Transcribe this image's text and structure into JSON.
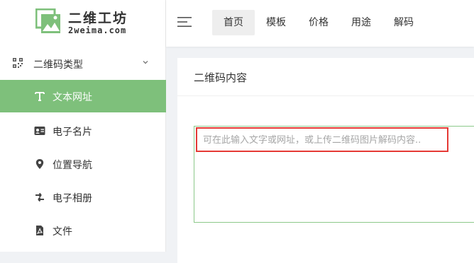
{
  "logo": {
    "title": "二维工坊",
    "subtitle": "2weima.com",
    "mark_icon": "qr-frame-mountain-icon"
  },
  "sidebar": {
    "group": {
      "label": "二维码类型",
      "icon": "qr-code-icon",
      "chevron": "chevron-down-icon"
    },
    "items": [
      {
        "label": "文本网址",
        "icon": "text-t-icon",
        "active": true
      },
      {
        "label": "电子名片",
        "icon": "id-card-icon",
        "active": false
      },
      {
        "label": "位置导航",
        "icon": "map-pin-icon",
        "active": false
      },
      {
        "label": "电子相册",
        "icon": "shuffle-arrows-icon",
        "active": false
      },
      {
        "label": "文件",
        "icon": "pdf-file-icon",
        "active": false
      }
    ]
  },
  "topbar": {
    "menu_icon": "hamburger-icon",
    "tabs": [
      {
        "label": "首页",
        "active": true
      },
      {
        "label": "模板",
        "active": false
      },
      {
        "label": "价格",
        "active": false
      },
      {
        "label": "用途",
        "active": false
      },
      {
        "label": "解码",
        "active": false
      }
    ]
  },
  "main": {
    "card_title": "二维码内容",
    "content_placeholder": "可在此输入文字或网址，或上传二维码图片解码内容.."
  },
  "colors": {
    "accent": "#7ec07b",
    "input_border": "#8cc98a",
    "highlight": "#e53935"
  }
}
